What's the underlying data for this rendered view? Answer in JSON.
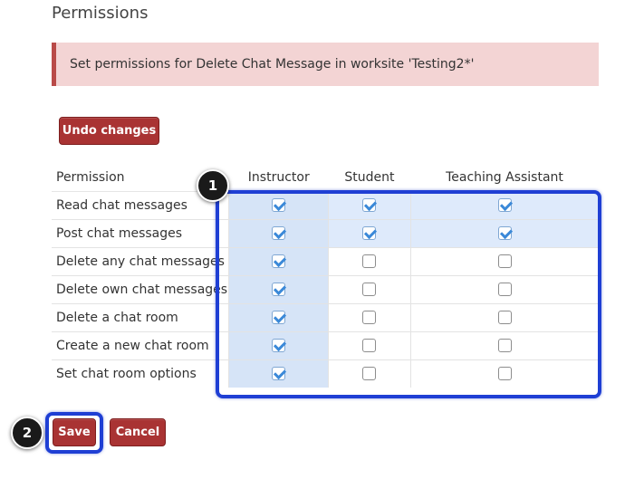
{
  "page": {
    "title": "Permissions",
    "alert": "Set permissions for Delete Chat Message in worksite 'Testing2*'"
  },
  "buttons": {
    "undo": "Undo changes",
    "save": "Save",
    "cancel": "Cancel"
  },
  "table": {
    "headers": [
      "Permission",
      "Instructor",
      "Student",
      "Teaching Assistant"
    ],
    "rows": [
      {
        "label": "Read chat messages",
        "checked": [
          true,
          true,
          true
        ]
      },
      {
        "label": "Post chat messages",
        "checked": [
          true,
          true,
          true
        ]
      },
      {
        "label": "Delete any chat messages",
        "checked": [
          true,
          false,
          false
        ]
      },
      {
        "label": "Delete own chat messages",
        "checked": [
          true,
          false,
          false
        ]
      },
      {
        "label": "Delete a chat room",
        "checked": [
          true,
          false,
          false
        ]
      },
      {
        "label": "Create a new chat room",
        "checked": [
          true,
          false,
          false
        ]
      },
      {
        "label": "Set chat room options",
        "checked": [
          true,
          false,
          false
        ]
      }
    ]
  },
  "callouts": [
    "1",
    "2"
  ],
  "colors": {
    "button": "#a93333",
    "alert_bg": "#f3d4d4",
    "alert_border": "#b94a48",
    "highlight": "#deeafb",
    "callout": "#1f3fd4",
    "checkmark": "#3b89d8"
  }
}
